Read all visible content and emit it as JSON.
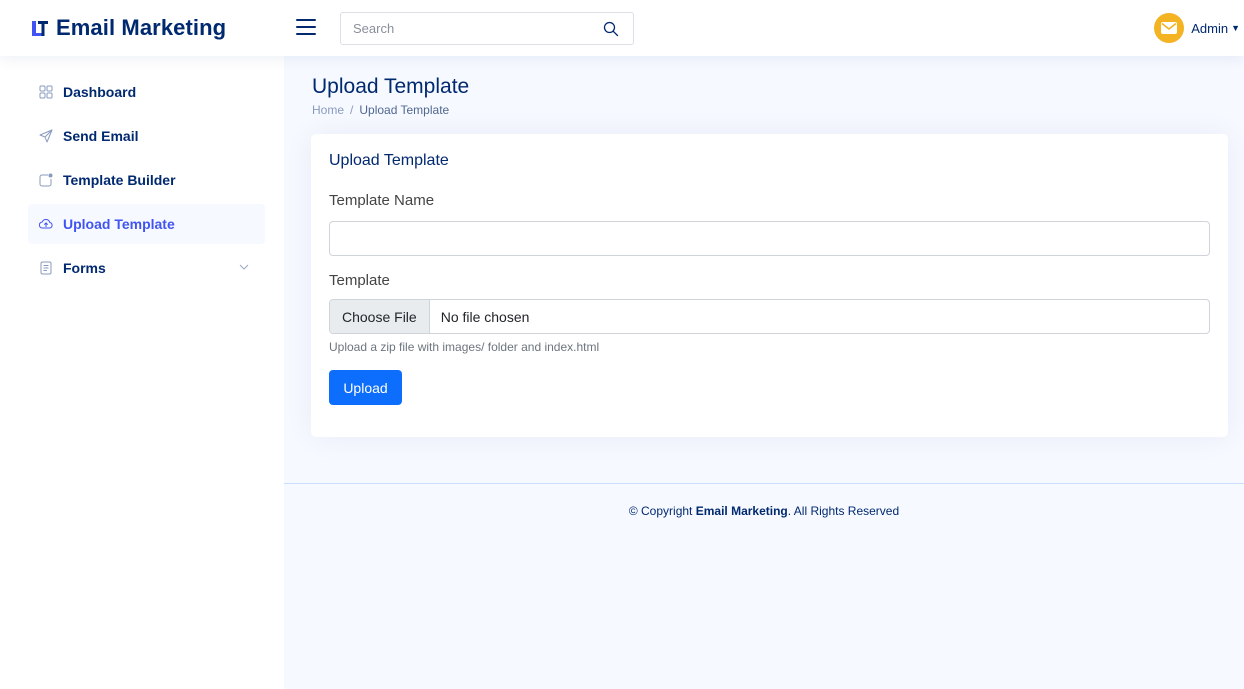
{
  "header": {
    "logo_text": "Email Marketing",
    "search": {
      "placeholder": "Search",
      "value": ""
    },
    "profile_name": "Admin"
  },
  "sidebar": {
    "items": [
      {
        "label": "Dashboard",
        "icon": "grid-icon",
        "active": false
      },
      {
        "label": "Send Email",
        "icon": "send-icon",
        "active": false
      },
      {
        "label": "Template Builder",
        "icon": "template-icon",
        "active": false
      },
      {
        "label": "Upload Template",
        "icon": "cloud-upload-icon",
        "active": true
      },
      {
        "label": "Forms",
        "icon": "form-icon",
        "active": false,
        "has_children": true
      }
    ]
  },
  "page": {
    "title": "Upload Template",
    "breadcrumb": {
      "home": "Home",
      "separator": "/",
      "current": "Upload Template"
    }
  },
  "card": {
    "title": "Upload Template",
    "template_name_label": "Template Name",
    "template_name_value": "",
    "template_label": "Template",
    "file_button": "Choose File",
    "file_status": "No file chosen",
    "help_text": "Upload a zip file with images/ folder and index.html",
    "upload_button": "Upload"
  },
  "footer": {
    "prefix": "© Copyright",
    "brand": "Email Marketing",
    "suffix": ". All Rights Reserved"
  },
  "colors": {
    "brand": "#012970",
    "accent": "#4154f1",
    "primary_button": "#0d6efd",
    "avatar": "#f3b323",
    "background": "#f6f9ff"
  }
}
